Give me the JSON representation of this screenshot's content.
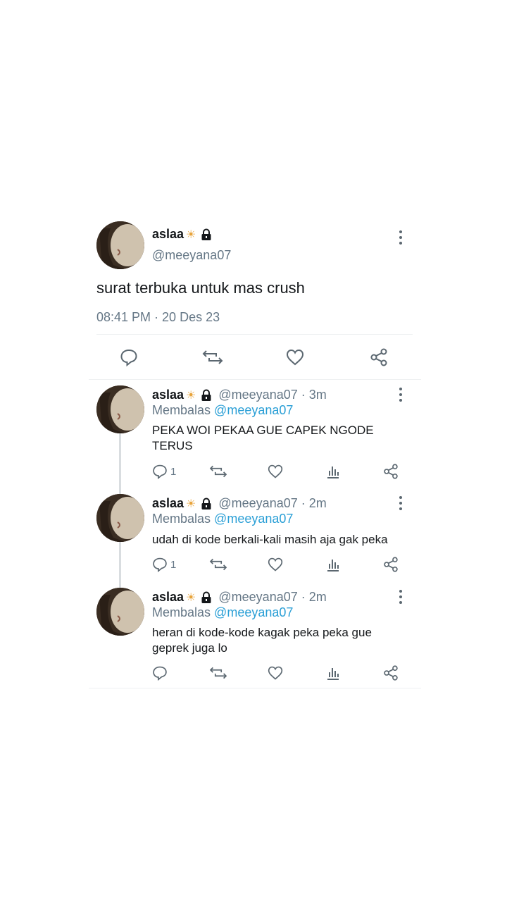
{
  "main_tweet": {
    "name": "aslaa",
    "handle": "@meeyana07",
    "text": "surat terbuka untuk mas crush",
    "timestamp": "08:41 PM · 20 Des 23"
  },
  "replies": [
    {
      "name": "aslaa",
      "handle": "@meeyana07 · 3m",
      "reply_prefix": "Membalas",
      "reply_mention": "@meeyana07",
      "text": "PEKA WOI PEKAA GUE CAPEK NGODE TERUS",
      "reply_count": "1"
    },
    {
      "name": "aslaa",
      "handle": "@meeyana07 · 2m",
      "reply_prefix": "Membalas",
      "reply_mention": "@meeyana07",
      "text": "udah di kode berkali-kali masih aja gak peka",
      "reply_count": "1"
    },
    {
      "name": "aslaa",
      "handle": "@meeyana07 · 2m",
      "reply_prefix": "Membalas",
      "reply_mention": "@meeyana07",
      "text": "heran di kode-kode kagak peka peka gue geprek juga lo",
      "reply_count": ""
    }
  ],
  "decorations": {
    "sun_glyph": "☀",
    "mention_color": "#2a9fd6",
    "icon_color": "#5b6770"
  }
}
